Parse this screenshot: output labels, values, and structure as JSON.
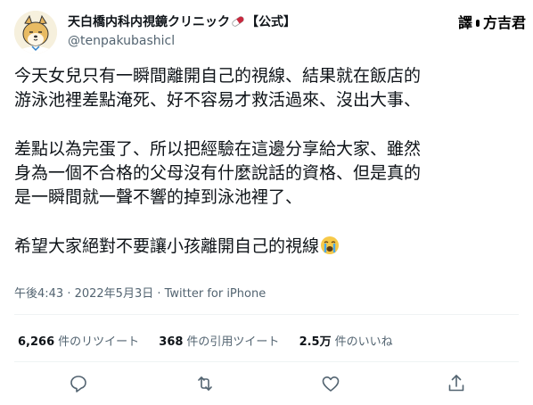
{
  "user": {
    "display_name": "天白橋内科内視鏡クリニック",
    "display_name_suffix": "【公式】",
    "handle": "@tenpakubashicl"
  },
  "translator_badge": {
    "label_left": "譯",
    "label_right": "方吉君"
  },
  "tweet": {
    "lines": [
      "今天女兒只有一瞬間離開自己的視線、結果就在飯店的",
      "游泳池裡差點淹死、好不容易才救活過來、沒出大事、",
      "差點以為完蛋了、所以把經驗在這邊分享給大家、雖然",
      "身為一個不合格的父母沒有什麼說話的資格、但是真的",
      "是一瞬間就一聲不響的掉到泳池裡了、",
      "希望大家絕對不要讓小孩離開自己的視線"
    ],
    "timestamp": "午後4:43 · 2022年5月3日 · Twitter for iPhone"
  },
  "stats": {
    "retweets_count": "6,266",
    "retweets_label": "件のリツイート",
    "quotes_count": "368",
    "quotes_label": "件の引用ツイート",
    "likes_count": "2.5万",
    "likes_label": "件のいいね"
  },
  "actions": [
    "reply-icon",
    "retweet-icon",
    "like-icon",
    "share-icon"
  ],
  "colors": {
    "text": "#0f1419",
    "secondary": "#536471",
    "divider": "#eff3f4"
  }
}
